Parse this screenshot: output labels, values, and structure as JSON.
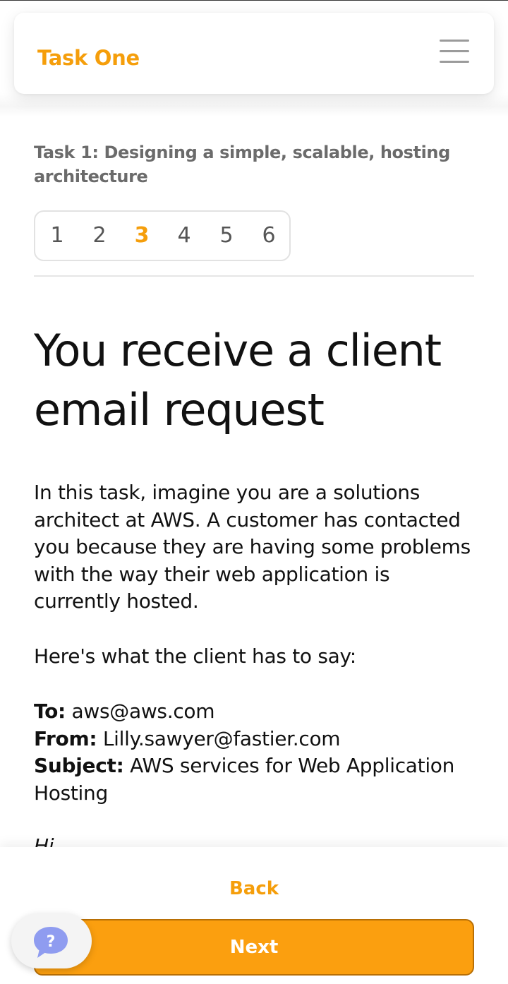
{
  "header": {
    "app_title": "Task One",
    "menu_icon": "hamburger-menu-icon"
  },
  "task": {
    "heading": "Task 1: Designing a simple, scalable, hosting architecture"
  },
  "pager": {
    "pages": [
      "1",
      "2",
      "3",
      "4",
      "5",
      "6"
    ],
    "current": "3"
  },
  "content": {
    "title": "You receive a client email request",
    "intro": "In this task, imagine you are a solutions architect at AWS. A customer has contacted you because they are having some problems with the way their web application is currently hosted.",
    "lead": "Here's what the client has to say:",
    "email": {
      "to_label": "To:",
      "to_value": "aws@aws.com",
      "from_label": "From:",
      "from_value": "Lilly.sawyer@fastier.com",
      "subject_label": "Subject:",
      "subject_value": "AWS services for Web Application Hosting"
    },
    "greeting": "Hi"
  },
  "footer": {
    "back_label": "Back",
    "next_label": "Next",
    "help_label": "?",
    "help_icon": "help-chat-bubble-icon"
  },
  "colors": {
    "accent": "#f59e0b",
    "help_bubble": "#8f9cf0"
  }
}
